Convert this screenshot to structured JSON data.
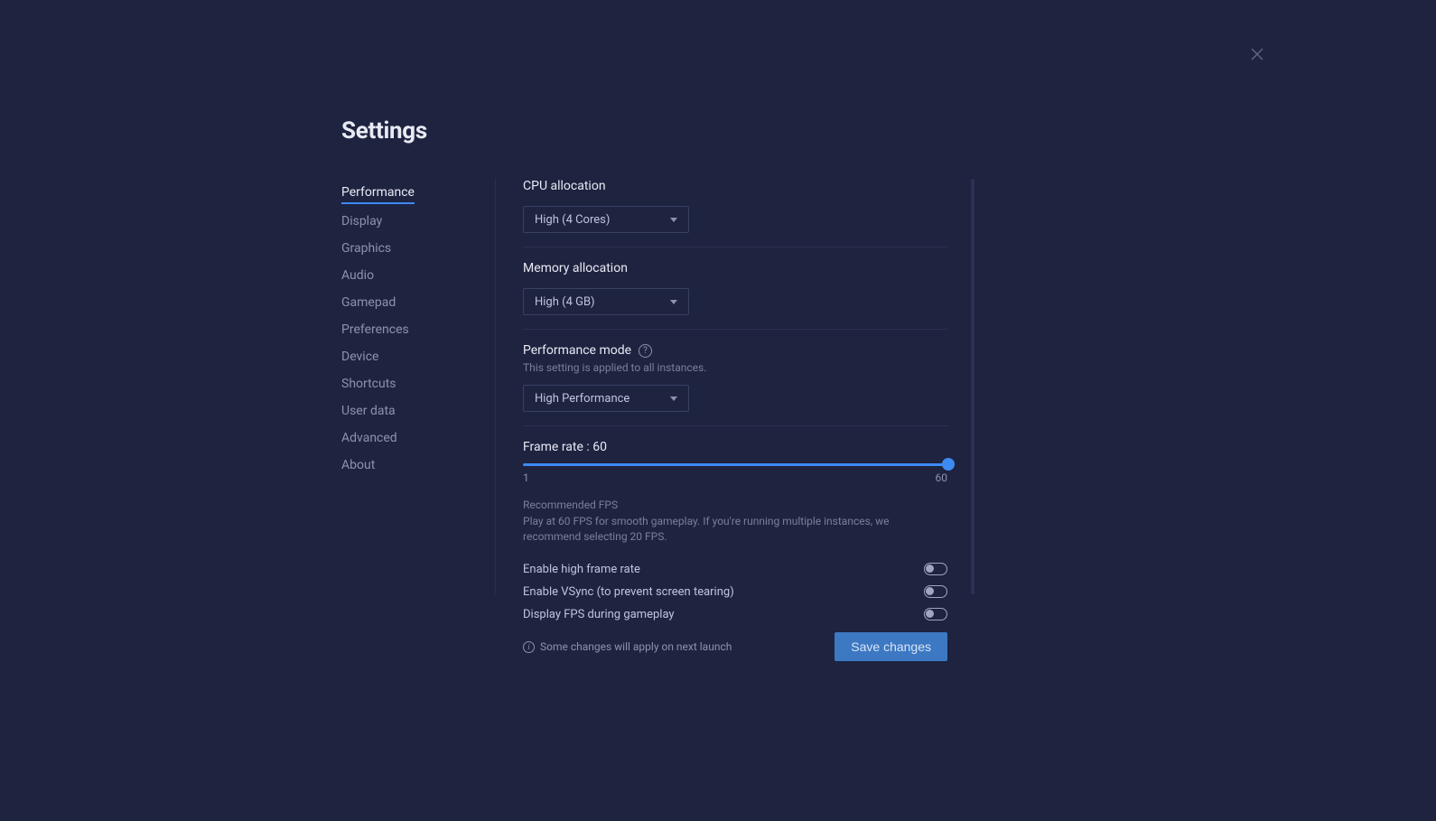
{
  "title": "Settings",
  "nav": {
    "items": [
      {
        "label": "Performance",
        "active": true
      },
      {
        "label": "Display"
      },
      {
        "label": "Graphics"
      },
      {
        "label": "Audio"
      },
      {
        "label": "Gamepad"
      },
      {
        "label": "Preferences"
      },
      {
        "label": "Device"
      },
      {
        "label": "Shortcuts"
      },
      {
        "label": "User data"
      },
      {
        "label": "Advanced"
      },
      {
        "label": "About"
      }
    ]
  },
  "cpu": {
    "label": "CPU allocation",
    "value": "High (4 Cores)"
  },
  "memory": {
    "label": "Memory allocation",
    "value": "High (4 GB)"
  },
  "perfMode": {
    "label": "Performance mode",
    "note": "This setting is applied to all instances.",
    "value": "High Performance"
  },
  "frameRate": {
    "label": "Frame rate : 60",
    "min": "1",
    "max": "60",
    "hintTitle": "Recommended FPS",
    "hintText": "Play at 60 FPS for smooth gameplay. If you're running multiple instances, we recommend selecting 20 FPS."
  },
  "toggles": {
    "highFrameRate": "Enable high frame rate",
    "vsync": "Enable VSync (to prevent screen tearing)",
    "displayFps": "Display FPS during gameplay"
  },
  "footer": {
    "note": "Some changes will apply on next launch",
    "save": "Save changes"
  }
}
